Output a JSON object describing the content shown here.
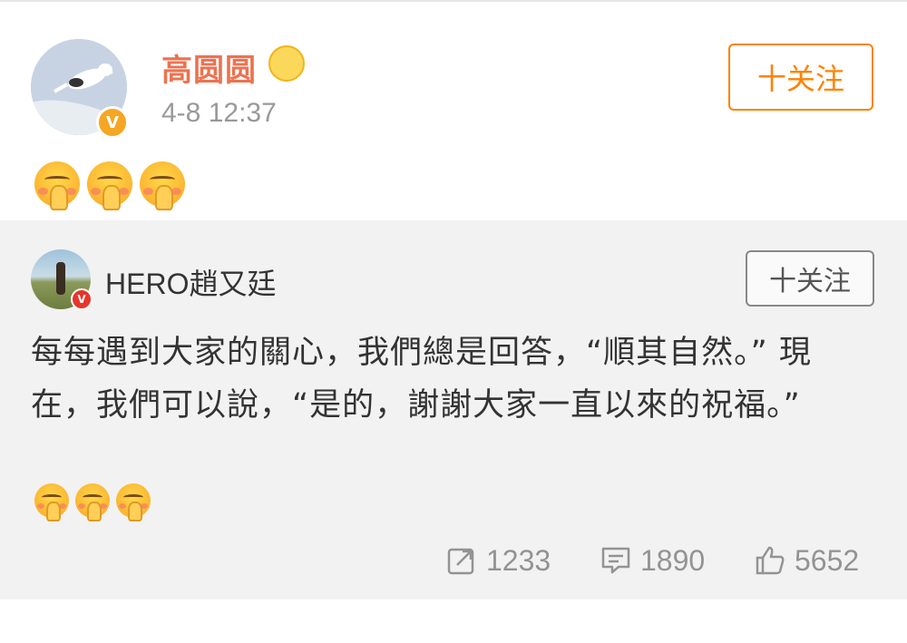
{
  "post": {
    "author": "高圆圆",
    "timestamp": "4-8 12:37",
    "follow_label": "十关注",
    "verified_symbol": "V"
  },
  "repost": {
    "author": "HERO趙又廷",
    "follow_label": "十关注",
    "verified_symbol": "V",
    "text": "每每遇到大家的關心，我們總是回答，“順其自然。” 現在，我們可以說，“是的，謝謝大家一直以來的祝福。”",
    "stats": {
      "reposts": "1233",
      "comments": "1890",
      "likes": "5652"
    }
  },
  "colors": {
    "accent": "#ff8200",
    "username": "#eb7350",
    "muted": "#999999",
    "card_bg": "#f2f2f2"
  },
  "icons": {
    "emoji": "praying-emoji",
    "crown": "crown-badge-icon",
    "verified": "verified-badge-icon",
    "repost": "share-icon",
    "comment": "comment-icon",
    "like": "thumbs-up-icon"
  }
}
